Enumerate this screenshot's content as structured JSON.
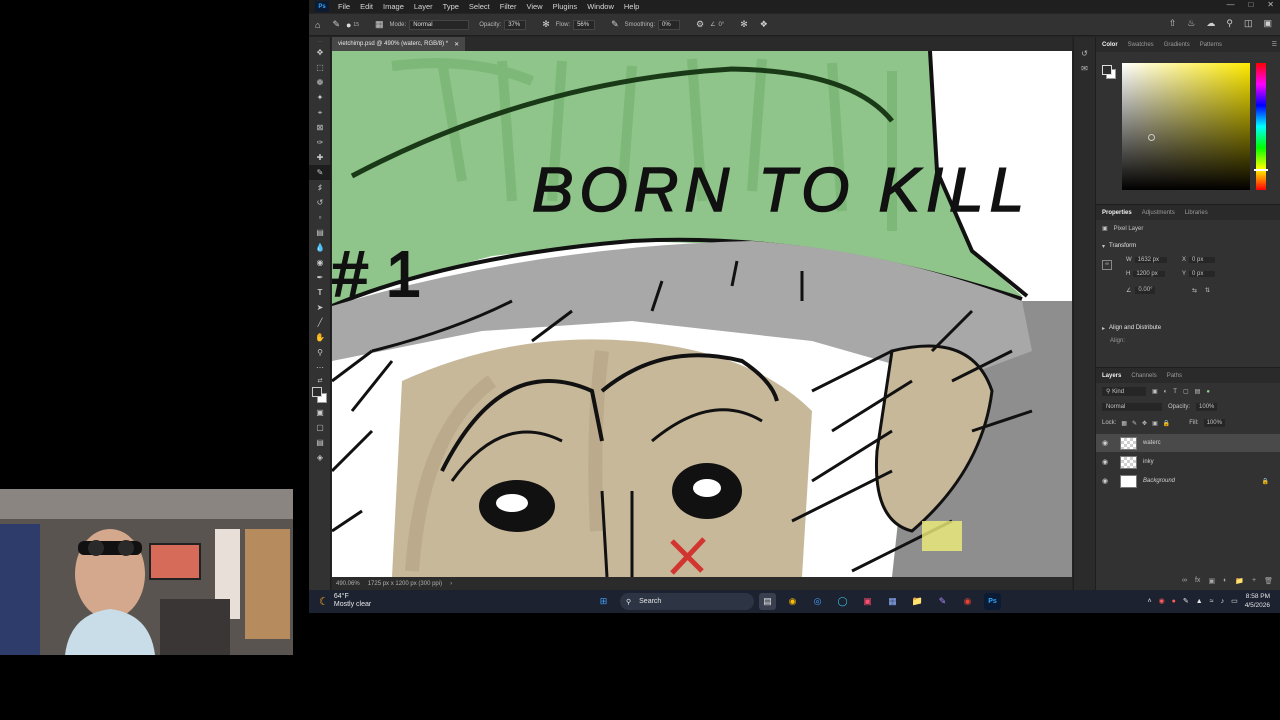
{
  "app": {
    "name": "Ps",
    "menus": [
      "File",
      "Edit",
      "Image",
      "Layer",
      "Type",
      "Select",
      "Filter",
      "View",
      "Plugins",
      "Window",
      "Help"
    ]
  },
  "options_bar": {
    "mode_label": "Mode:",
    "mode_value": "Normal",
    "opacity_label": "Opacity:",
    "opacity_value": "37%",
    "flow_label": "Flow:",
    "flow_value": "56%",
    "smoothing_label": "Smoothing:",
    "smoothing_value": "0%",
    "angle_value": "0°",
    "brush_size": "15"
  },
  "document": {
    "tab_title": "vietchimp.psd @ 490% (waterc, RGB/8) *",
    "status_zoom": "490.06%",
    "status_info": "1725 px x 1200 px (300 ppi)",
    "artwork_text": "BORN TO KILL",
    "artwork_tally": "#1"
  },
  "color_panel": {
    "tabs": [
      "Color",
      "Swatches",
      "Gradients",
      "Patterns"
    ],
    "active_tab": "Color",
    "hue_color": "#ffea00"
  },
  "properties_panel": {
    "tabs": [
      "Properties",
      "Adjustments",
      "Libraries"
    ],
    "layer_type": "Pixel Layer",
    "transform_label": "Transform",
    "w_label": "W",
    "w_value": "1632 px",
    "h_label": "H",
    "h_value": "1200 px",
    "x_label": "X",
    "x_value": "0 px",
    "y_label": "Y",
    "y_value": "0 px",
    "angle_value": "0.00°",
    "align_label": "Align and Distribute",
    "align_sub": "Align:"
  },
  "layers_panel": {
    "tabs": [
      "Layers",
      "Channels",
      "Paths"
    ],
    "filter_label": "Kind",
    "blend_mode": "Normal",
    "opacity_label": "Opacity:",
    "opacity_value": "100%",
    "lock_label": "Lock:",
    "fill_label": "Fill:",
    "fill_value": "100%",
    "layers": [
      {
        "name": "waterc",
        "selected": true
      },
      {
        "name": "inky",
        "selected": false
      },
      {
        "name": "Background",
        "selected": false
      }
    ]
  },
  "taskbar": {
    "temperature": "64°F",
    "weather": "Mostly clear",
    "search_placeholder": "Search",
    "time": "8:58 PM",
    "date": "4/5/2026"
  },
  "colors": {
    "hat_green": "#8fc48a",
    "skin": "#c8b89a",
    "accent_red": "#d2352f",
    "taskbar_bg": "#1c2230"
  }
}
